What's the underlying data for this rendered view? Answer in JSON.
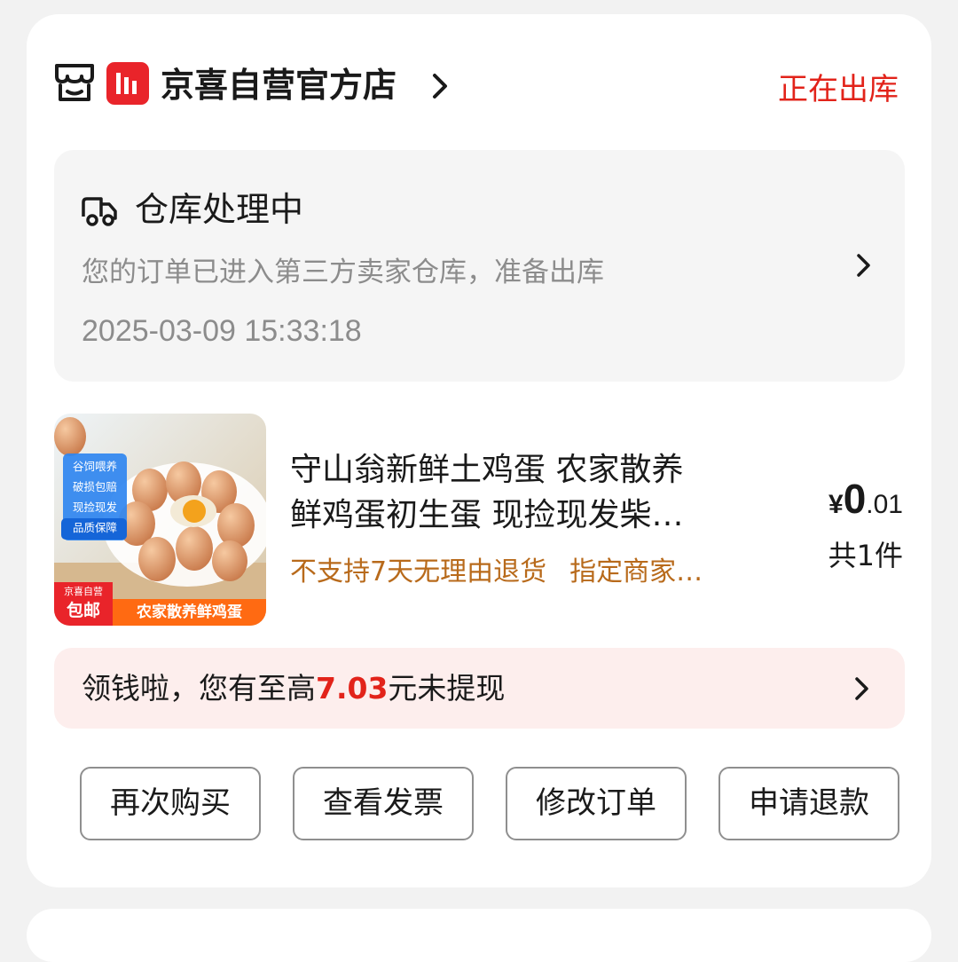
{
  "store": {
    "name": "京喜自营官方店",
    "status": "正在出库",
    "brand_color": "#e9242a"
  },
  "logistics": {
    "title": "仓库处理中",
    "description": "您的订单已进入第三方卖家仓库，准备出库",
    "time": "2025-03-09 15:33:18"
  },
  "product": {
    "title_line1": "守山翁新鲜土鸡蛋 农家散养",
    "title_line2": "鲜鸡蛋初生蛋 现捡现发柴…",
    "tag1": "不支持7天无理由退货",
    "tag2": "指定商家…",
    "price_currency": "¥",
    "price_int": "0",
    "price_dec": ".01",
    "quantity": "共1件",
    "image": {
      "badges": [
        "谷饲喂养",
        "破损包赔",
        "现捡现发",
        "品质保障"
      ],
      "corner_small": "京喜自营",
      "corner_big": "包邮",
      "banner": "农家散养鲜鸡蛋"
    }
  },
  "promo": {
    "text_before": "领钱啦，您有至高",
    "amount": "7.03",
    "text_after": "元未提现",
    "amount_color": "#e2231a"
  },
  "actions": {
    "buy_again": "再次购买",
    "view_invoice": "查看发票",
    "modify_order": "修改订单",
    "request_refund": "申请退款"
  },
  "colors": {
    "accent_red": "#e2231a",
    "tag_orange": "#b86a1b",
    "promo_bg": "#fdeeed"
  }
}
